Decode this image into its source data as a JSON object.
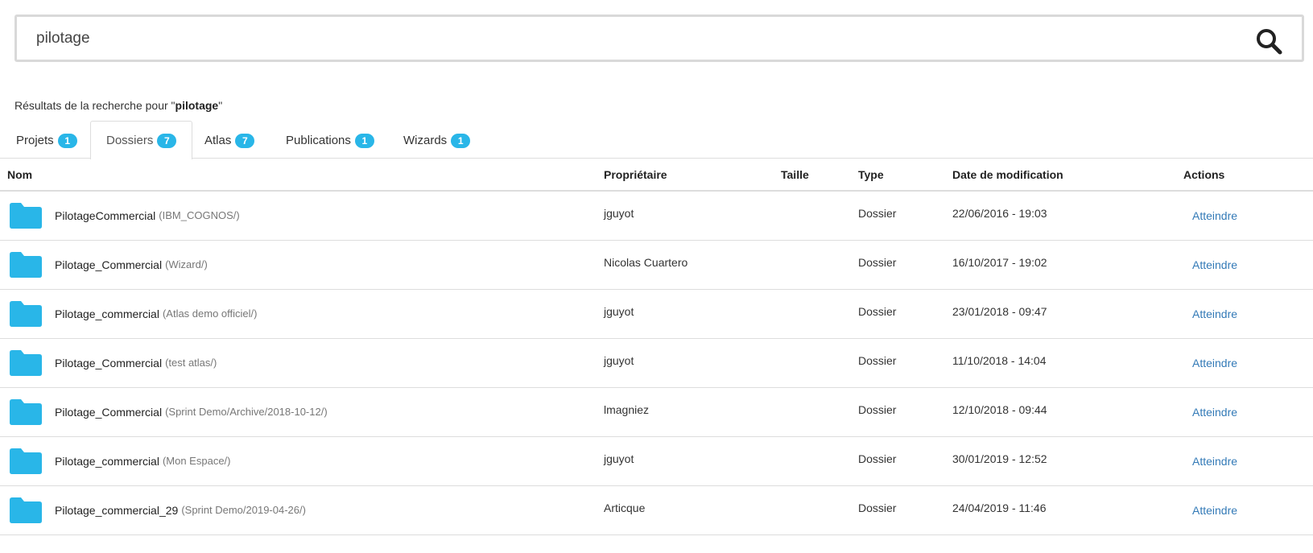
{
  "search": {
    "value": "pilotage",
    "placeholder": ""
  },
  "results_caption": {
    "prefix": "Résultats de la recherche pour \"",
    "query": "pilotage",
    "suffix": "\""
  },
  "tabs": [
    {
      "label": "Projets",
      "count": "1",
      "active": false
    },
    {
      "label": "Dossiers",
      "count": "7",
      "active": true
    },
    {
      "label": "Atlas",
      "count": "7",
      "active": false
    },
    {
      "label": "Publications",
      "count": "1",
      "active": false
    },
    {
      "label": "Wizards",
      "count": "1",
      "active": false
    }
  ],
  "table": {
    "headers": {
      "name": "Nom",
      "owner": "Propriétaire",
      "size": "Taille",
      "type": "Type",
      "date": "Date de modification",
      "actions": "Actions"
    },
    "rows": [
      {
        "name": "PilotageCommercial",
        "path": "(IBM_COGNOS/)",
        "owner": "jguyot",
        "size": "",
        "type": "Dossier",
        "date": "22/06/2016 - 19:03",
        "action": "Atteindre"
      },
      {
        "name": "Pilotage_Commercial",
        "path": "(Wizard/)",
        "owner": "Nicolas Cuartero",
        "size": "",
        "type": "Dossier",
        "date": "16/10/2017 - 19:02",
        "action": "Atteindre"
      },
      {
        "name": "Pilotage_commercial",
        "path": "(Atlas demo officiel/)",
        "owner": "jguyot",
        "size": "",
        "type": "Dossier",
        "date": "23/01/2018 - 09:47",
        "action": "Atteindre"
      },
      {
        "name": "Pilotage_Commercial",
        "path": "(test atlas/)",
        "owner": "jguyot",
        "size": "",
        "type": "Dossier",
        "date": "11/10/2018 - 14:04",
        "action": "Atteindre"
      },
      {
        "name": "Pilotage_Commercial",
        "path": "(Sprint Demo/Archive/2018-10-12/)",
        "owner": "lmagniez",
        "size": "",
        "type": "Dossier",
        "date": "12/10/2018 - 09:44",
        "action": "Atteindre"
      },
      {
        "name": "Pilotage_commercial",
        "path": "(Mon Espace/)",
        "owner": "jguyot",
        "size": "",
        "type": "Dossier",
        "date": "30/01/2019 - 12:52",
        "action": "Atteindre"
      },
      {
        "name": "Pilotage_commercial_29",
        "path": "(Sprint Demo/2019-04-26/)",
        "owner": "Articque",
        "size": "",
        "type": "Dossier",
        "date": "24/04/2019 - 11:46",
        "action": "Atteindre"
      }
    ]
  },
  "colors": {
    "accent": "#29b6e8",
    "folder": "#29b6e8",
    "link": "#337ab7",
    "border": "#dddddd"
  },
  "icons": {
    "search": "search-icon",
    "folder": "folder-icon"
  }
}
